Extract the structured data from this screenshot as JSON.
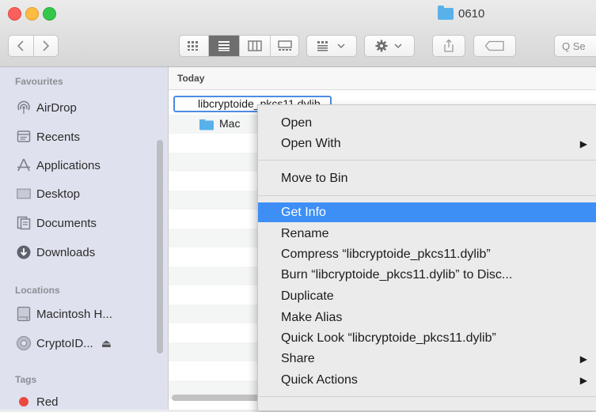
{
  "window": {
    "title": "0610"
  },
  "toolbar": {
    "search_placeholder": "Q Se"
  },
  "sidebar": {
    "favourites_header": "Favourites",
    "favourites": [
      {
        "label": "AirDrop",
        "icon": "airdrop-icon"
      },
      {
        "label": "Recents",
        "icon": "recents-icon"
      },
      {
        "label": "Applications",
        "icon": "applications-icon"
      },
      {
        "label": "Desktop",
        "icon": "desktop-icon"
      },
      {
        "label": "Documents",
        "icon": "documents-icon"
      },
      {
        "label": "Downloads",
        "icon": "downloads-icon"
      }
    ],
    "locations_header": "Locations",
    "locations": [
      {
        "label": "Macintosh H...",
        "icon": "hard-disk-icon"
      },
      {
        "label": "CryptoID...",
        "icon": "disk-icon",
        "eject": "⏏"
      }
    ],
    "tags_header": "Tags",
    "tags": [
      {
        "label": "Red",
        "color": "#e9493f"
      }
    ]
  },
  "list": {
    "section_header": "Today",
    "files": [
      {
        "name": "libcryptoide_pkcs11.dylib",
        "selected": true
      },
      {
        "name": "Mac",
        "type": "folder"
      }
    ]
  },
  "context_menu": {
    "items": [
      {
        "label": "Open"
      },
      {
        "label": "Open With",
        "submenu": true
      },
      {
        "label": "Move to Bin"
      },
      {
        "label": "Get Info",
        "highlighted": true
      },
      {
        "label": "Rename"
      },
      {
        "label": "Compress “libcryptoide_pkcs11.dylib”"
      },
      {
        "label": "Burn “libcryptoide_pkcs11.dylib” to Disc..."
      },
      {
        "label": "Duplicate"
      },
      {
        "label": "Make Alias"
      },
      {
        "label": "Quick Look “libcryptoide_pkcs11.dylib”"
      },
      {
        "label": "Share",
        "submenu": true
      },
      {
        "label": "Quick Actions",
        "submenu": true
      }
    ],
    "submenu_arrow": "▶"
  }
}
